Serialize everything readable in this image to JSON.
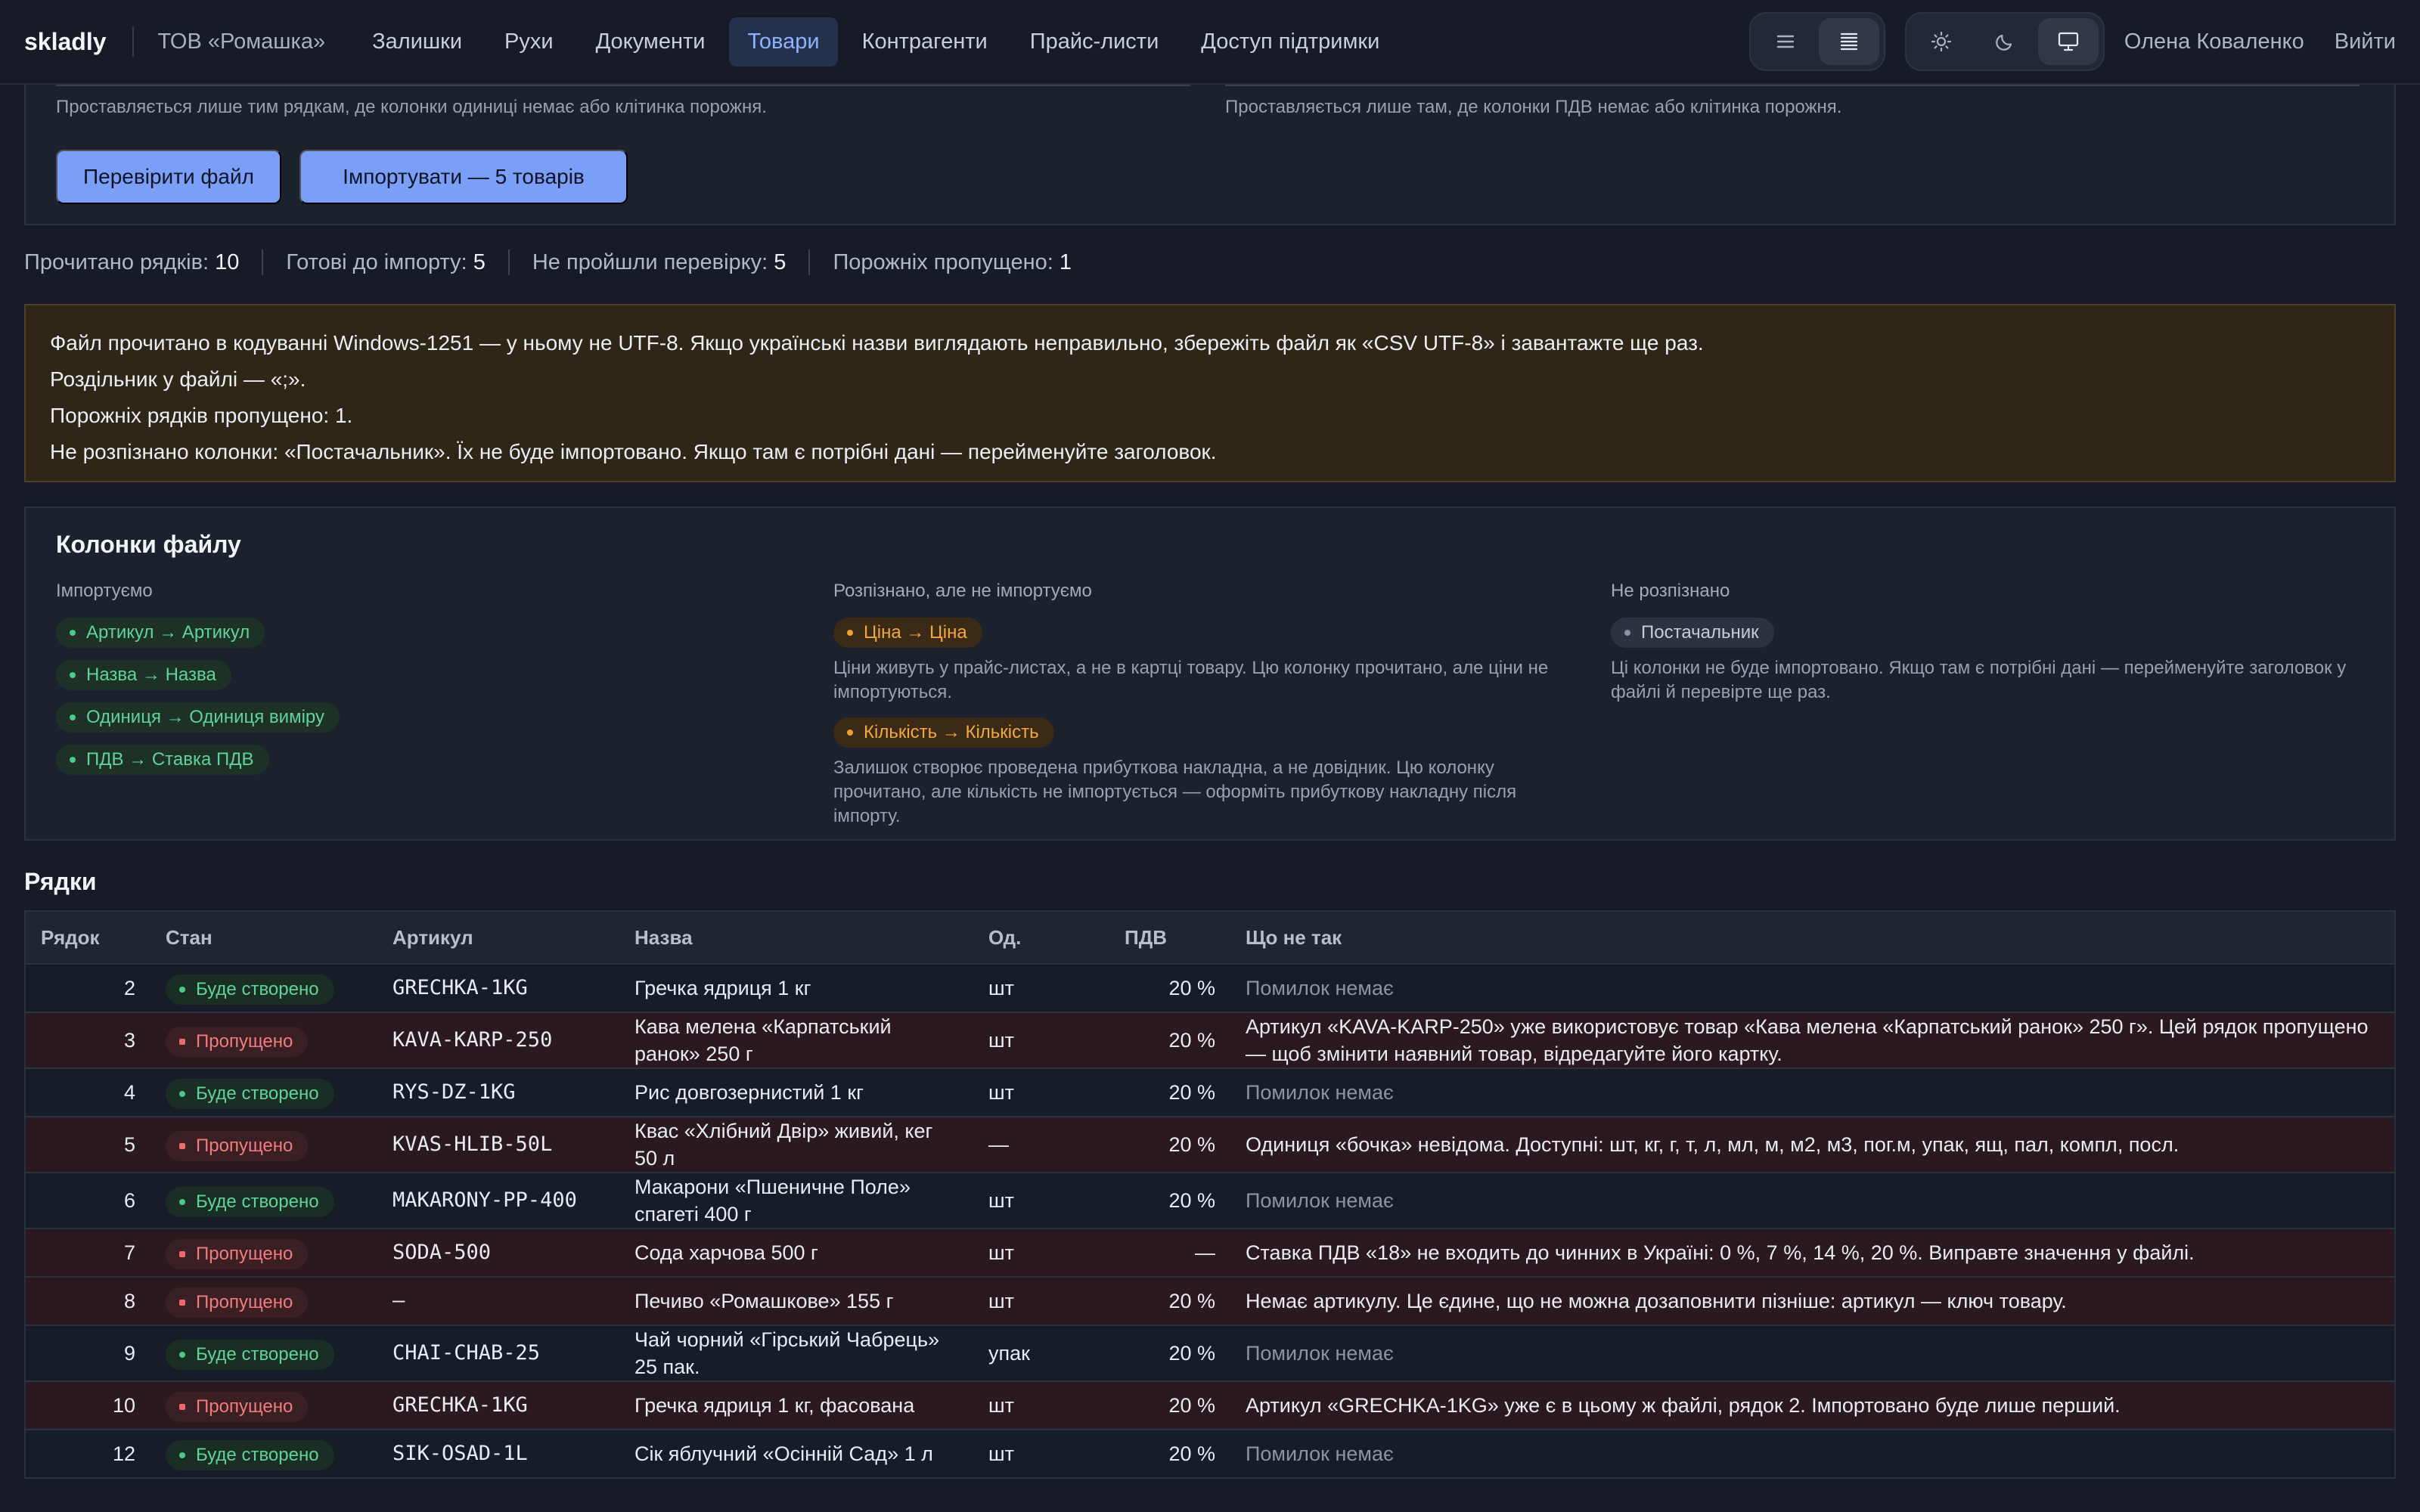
{
  "header": {
    "brand": "skladly",
    "org": "ТОВ «Ромашка»",
    "nav": [
      "Залишки",
      "Рухи",
      "Документи",
      "Товари",
      "Контрагенти",
      "Прайс-листи",
      "Доступ підтримки"
    ],
    "active_nav": "Товари",
    "view_toggle_icons": [
      "list-icon",
      "dense-list-icon"
    ],
    "theme_toggle_icons": [
      "sun-icon",
      "moon-icon",
      "monitor-icon"
    ],
    "user": "Олена Коваленко",
    "logout": "Вийти"
  },
  "import_settings": {
    "unit_hint": "Проставляється лише тим рядкам, де колонки одиниці немає або клітинка порожня.",
    "vat_hint": "Проставляється лише там, де колонки ПДВ немає або клітинка порожня.",
    "check_button": "Перевірити файл",
    "import_button": "Імпортувати — 5 товарів"
  },
  "stats": [
    {
      "label": "Прочитано рядків:",
      "value": "10"
    },
    {
      "label": "Готові до імпорту:",
      "value": "5"
    },
    {
      "label": "Не пройшли перевірку:",
      "value": "5"
    },
    {
      "label": "Порожніх пропущено:",
      "value": "1"
    }
  ],
  "warnings": [
    "Файл прочитано в кодуванні Windows-1251 — у ньому не UTF-8. Якщо українські назви виглядають неправильно, збережіть файл як «CSV UTF-8» і завантажте ще раз.",
    "Роздільник у файлі — «;».",
    "Порожніх рядків пропущено: 1.",
    "Не розпізнано колонки: «Постачальник». Їх не буде імпортовано. Якщо там є потрібні дані — перейменуйте заголовок."
  ],
  "columns": {
    "title": "Колонки файлу",
    "imported": {
      "title": "Імпортуємо",
      "items": [
        "Артикул → Артикул",
        "Назва → Назва",
        "Одиниця → Одиниця виміру",
        "ПДВ → Ставка ПДВ"
      ]
    },
    "recognized": {
      "title": "Розпізнано, але не імпортуємо",
      "items": [
        {
          "label": "Ціна → Ціна",
          "note": "Ціни живуть у прайс-листах, а не в картці товару. Цю колонку прочитано, але ціни не імпортуються."
        },
        {
          "label": "Кількість → Кількість",
          "note": "Залишок створює проведена прибуткова накладна, а не довідник. Цю колонку прочитано, але кількість не імпортується — оформіть прибуткову накладну після імпорту."
        }
      ]
    },
    "unrecognized": {
      "title": "Не розпізнано",
      "items": [
        "Постачальник"
      ],
      "note": "Ці колонки не буде імпортовано. Якщо там є потрібні дані — перейменуйте заголовок у файлі й перевірте ще раз."
    }
  },
  "rows_section": {
    "title": "Рядки",
    "headers": [
      "Рядок",
      "Стан",
      "Артикул",
      "Назва",
      "Од.",
      "ПДВ",
      "Що не так"
    ],
    "rows": [
      {
        "n": "2",
        "state": "Буде створено",
        "ok": true,
        "sku": "GRECHKA-1KG",
        "name": "Гречка ядриця 1 кг",
        "unit": "шт",
        "vat": "20 %",
        "issue": "Помилок немає"
      },
      {
        "n": "3",
        "state": "Пропущено",
        "ok": false,
        "sku": "KAVA-KARP-250",
        "name": "Кава мелена «Карпатський ранок» 250 г",
        "unit": "шт",
        "vat": "20 %",
        "issue": "Артикул «KAVA-KARP-250» уже використовує товар «Кава мелена «Карпатський ранок» 250 г». Цей рядок пропущено — щоб змінити наявний товар, відредагуйте його картку."
      },
      {
        "n": "4",
        "state": "Буде створено",
        "ok": true,
        "sku": "RYS-DZ-1KG",
        "name": "Рис довгозернистий 1 кг",
        "unit": "шт",
        "vat": "20 %",
        "issue": "Помилок немає"
      },
      {
        "n": "5",
        "state": "Пропущено",
        "ok": false,
        "sku": "KVAS-HLIB-50L",
        "name": "Квас «Хлібний Двір» живий, кег 50 л",
        "unit": "—",
        "vat": "20 %",
        "issue": "Одиниця «бочка» невідома. Доступні: шт, кг, г, т, л, мл, м, м2, м3, пог.м, упак, ящ, пал, компл, посл."
      },
      {
        "n": "6",
        "state": "Буде створено",
        "ok": true,
        "sku": "MAKARONY-PP-400",
        "name": "Макарони «Пшеничне Поле» спагеті 400 г",
        "unit": "шт",
        "vat": "20 %",
        "issue": "Помилок немає"
      },
      {
        "n": "7",
        "state": "Пропущено",
        "ok": false,
        "sku": "SODA-500",
        "name": "Сода харчова 500 г",
        "unit": "шт",
        "vat": "—",
        "issue": "Ставка ПДВ «18» не входить до чинних в Україні: 0 %, 7 %, 14 %, 20 %. Виправте значення у файлі."
      },
      {
        "n": "8",
        "state": "Пропущено",
        "ok": false,
        "sku": "—",
        "name": "Печиво «Ромашкове» 155 г",
        "unit": "шт",
        "vat": "20 %",
        "issue": "Немає артикулу. Це єдине, що не можна дозаповнити пізніше: артикул — ключ товару."
      },
      {
        "n": "9",
        "state": "Буде створено",
        "ok": true,
        "sku": "CHAI-CHAB-25",
        "name": "Чай чорний «Гірський Чабрець» 25 пак.",
        "unit": "упак",
        "vat": "20 %",
        "issue": "Помилок немає"
      },
      {
        "n": "10",
        "state": "Пропущено",
        "ok": false,
        "sku": "GRECHKA-1KG",
        "name": "Гречка ядриця 1 кг, фасована",
        "unit": "шт",
        "vat": "20 %",
        "issue": "Артикул «GRECHKA-1KG» уже є в цьому ж файлі, рядок 2. Імпортовано буде лише перший."
      },
      {
        "n": "12",
        "state": "Буде створено",
        "ok": true,
        "sku": "SIK-OSAD-1L",
        "name": "Сік яблучний «Осінній Сад» 1 л",
        "unit": "шт",
        "vat": "20 %",
        "issue": "Помилок немає"
      }
    ]
  }
}
